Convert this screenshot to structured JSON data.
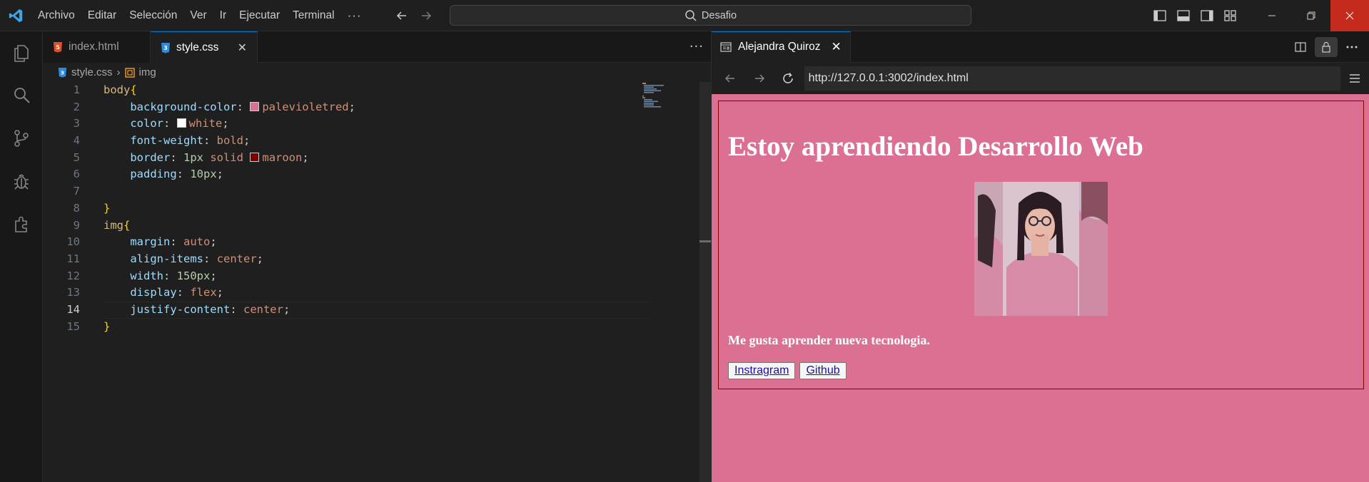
{
  "window": {
    "menu": [
      "Archivo",
      "Editar",
      "Selección",
      "Ver",
      "Ir",
      "Ejecutar",
      "Terminal"
    ],
    "menu_more": "···",
    "search_text": "Desafio"
  },
  "activity_bar": [
    "files-icon",
    "search-icon",
    "source-control-icon",
    "debug-icon",
    "extensions-icon"
  ],
  "editor": {
    "tabs": [
      {
        "label": "index.html",
        "icon": "html-file-icon",
        "active": false
      },
      {
        "label": "style.css",
        "icon": "css-file-icon",
        "active": true
      }
    ],
    "tabs_more": "···",
    "breadcrumb": {
      "file": "style.css",
      "symbol": "img"
    },
    "current_line": 14,
    "lines": [
      {
        "n": "1",
        "tokens": [
          [
            "sel",
            "body"
          ],
          [
            "brace",
            "{"
          ]
        ]
      },
      {
        "n": "2",
        "tokens": [
          [
            "ind",
            "    "
          ],
          [
            "prop",
            "background-color"
          ],
          [
            "punc",
            ": "
          ],
          [
            "swatch",
            "#db7093"
          ],
          [
            "val",
            "palevioletred"
          ],
          [
            "punc",
            ";"
          ]
        ]
      },
      {
        "n": "3",
        "tokens": [
          [
            "ind",
            "    "
          ],
          [
            "prop",
            "color"
          ],
          [
            "punc",
            ": "
          ],
          [
            "swatch",
            "#ffffff"
          ],
          [
            "val",
            "white"
          ],
          [
            "punc",
            ";"
          ]
        ]
      },
      {
        "n": "4",
        "tokens": [
          [
            "ind",
            "    "
          ],
          [
            "prop",
            "font-weight"
          ],
          [
            "punc",
            ": "
          ],
          [
            "val",
            "bold"
          ],
          [
            "punc",
            ";"
          ]
        ]
      },
      {
        "n": "5",
        "tokens": [
          [
            "ind",
            "    "
          ],
          [
            "prop",
            "border"
          ],
          [
            "punc",
            ": "
          ],
          [
            "num",
            "1px"
          ],
          [
            "punc",
            " "
          ],
          [
            "val",
            "solid"
          ],
          [
            "punc",
            " "
          ],
          [
            "swatch",
            "#800000"
          ],
          [
            "val",
            "maroon"
          ],
          [
            "punc",
            ";"
          ]
        ]
      },
      {
        "n": "6",
        "tokens": [
          [
            "ind",
            "    "
          ],
          [
            "prop",
            "padding"
          ],
          [
            "punc",
            ": "
          ],
          [
            "num",
            "10px"
          ],
          [
            "punc",
            ";"
          ]
        ]
      },
      {
        "n": "7",
        "tokens": []
      },
      {
        "n": "8",
        "tokens": [
          [
            "brace",
            "}"
          ]
        ]
      },
      {
        "n": "9",
        "tokens": [
          [
            "sel",
            "img"
          ],
          [
            "brace",
            "{"
          ]
        ]
      },
      {
        "n": "10",
        "tokens": [
          [
            "ind",
            "    "
          ],
          [
            "prop",
            "margin"
          ],
          [
            "punc",
            ": "
          ],
          [
            "val",
            "auto"
          ],
          [
            "punc",
            ";"
          ]
        ]
      },
      {
        "n": "11",
        "tokens": [
          [
            "ind",
            "    "
          ],
          [
            "prop",
            "align-items"
          ],
          [
            "punc",
            ": "
          ],
          [
            "val",
            "center"
          ],
          [
            "punc",
            ";"
          ]
        ]
      },
      {
        "n": "12",
        "tokens": [
          [
            "ind",
            "    "
          ],
          [
            "prop",
            "width"
          ],
          [
            "punc",
            ": "
          ],
          [
            "num",
            "150px"
          ],
          [
            "punc",
            ";"
          ]
        ]
      },
      {
        "n": "13",
        "tokens": [
          [
            "ind",
            "    "
          ],
          [
            "prop",
            "display"
          ],
          [
            "punc",
            ": "
          ],
          [
            "val",
            "flex"
          ],
          [
            "punc",
            ";"
          ]
        ]
      },
      {
        "n": "14",
        "tokens": [
          [
            "ind",
            "    "
          ],
          [
            "prop",
            "justify-content"
          ],
          [
            "punc",
            ": "
          ],
          [
            "val",
            "center"
          ],
          [
            "punc",
            ";"
          ]
        ]
      },
      {
        "n": "15",
        "tokens": [
          [
            "brace",
            "}"
          ]
        ]
      }
    ]
  },
  "browser": {
    "tab_title": "Alejandra Quiroz",
    "url": "http://127.0.0.1:3002/index.html",
    "page": {
      "heading": "Estoy aprendiendo Desarrollo Web",
      "paragraph": "Me gusta aprender nueva tecnologia.",
      "links": [
        "Instragram",
        "Github"
      ],
      "bg_color": "#db7093"
    }
  },
  "colors": {
    "accent": "#0078d4",
    "close_button": "#c42b1c"
  }
}
